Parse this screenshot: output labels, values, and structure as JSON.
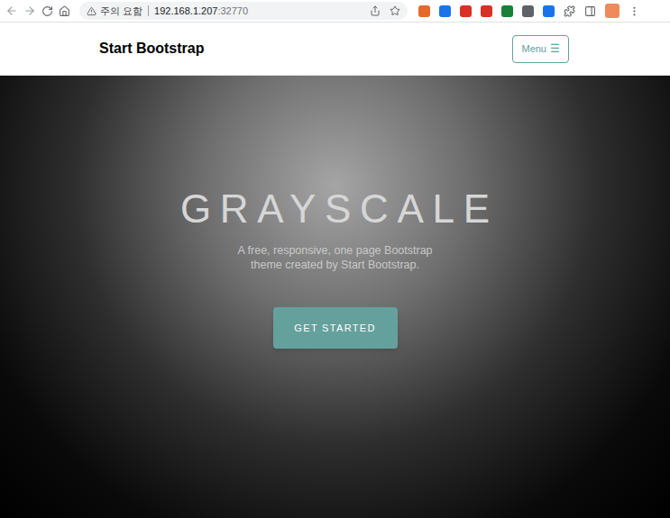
{
  "browser": {
    "warning": "주의 요함",
    "url_host": "192.168.1.207",
    "url_port": ":32770"
  },
  "navbar": {
    "brand": "Start Bootstrap",
    "menu_label": "Menu",
    "menu_glyph": "☰"
  },
  "hero": {
    "title": "GRAYSCALE",
    "subtitle_lines": [
      "A free, responsive, one page Bootstrap",
      "theme created by Start Bootstrap."
    ],
    "button": "GET STARTED"
  }
}
